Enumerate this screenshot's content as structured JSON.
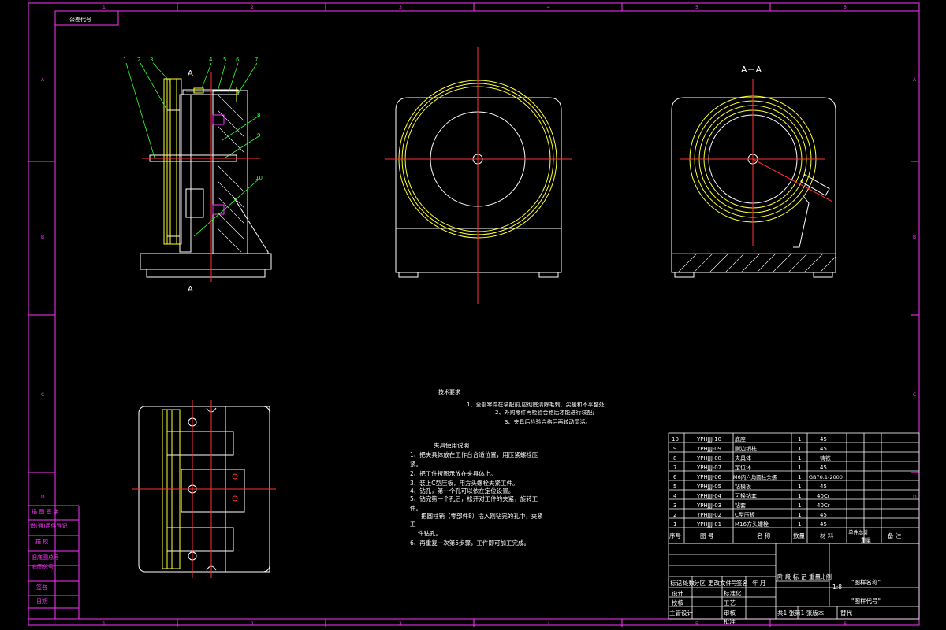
{
  "title_block_top_left": "公差代号",
  "zone_numbers": [
    "1",
    "2",
    "3",
    "4",
    "5",
    "6"
  ],
  "zone_letters": [
    "A",
    "B",
    "C",
    "D"
  ],
  "section_label": "A－A",
  "section_marker_top": "A",
  "section_marker_bottom": "A",
  "balloons": [
    "1",
    "2",
    "3",
    "4",
    "5",
    "6",
    "7",
    "8",
    "9",
    "10"
  ],
  "tech_requirements": {
    "title": "技术要求",
    "items": [
      "1、全部零件在装配前,应彻底清除毛刺、尖棱和不平整处;",
      "2、外购零件再检验合格后才能进行装配;",
      "3、夹具后检验合格后再转动灵活。"
    ]
  },
  "usage": {
    "title": "夹具使用说明",
    "lines": [
      "1、把夹具体放在工作台合适位置，用压紧螺栓压",
      "紧。",
      "2、把工件按图示放在夹具体上。",
      "3、装上C型压板，用方头螺栓夹紧工件。",
      "4、钻孔，第一个孔可以依在定位设置。",
      "5、钻完第一个孔后，松开对工件的夹紧，旋转工",
      "件。",
      "把圆柱销（零部件8）插入刚钻完的孔中，夹紧",
      "工",
      "件钻孔。",
      "6、再重复一次第5步骤，工件即可加工完成。"
    ]
  },
  "bom": {
    "rows": [
      {
        "no": "10",
        "code": "YPHJJJ-10",
        "name": "底座",
        "qty": "1",
        "material": "45"
      },
      {
        "no": "9",
        "code": "YPHJJJ-09",
        "name": "削边销柱",
        "qty": "1",
        "material": "45"
      },
      {
        "no": "8",
        "code": "YPHJJJ-08",
        "name": "夹具体",
        "qty": "1",
        "material": "铸铁"
      },
      {
        "no": "7",
        "code": "YPHJJJ-07",
        "name": "定位环",
        "qty": "1",
        "material": "45"
      },
      {
        "no": "6",
        "code": "YPHJJJ-06",
        "name": "M6内六角圆柱头螺",
        "qty": "1",
        "material": "GB70.1-2000"
      },
      {
        "no": "5",
        "code": "YPHJJJ-05",
        "name": "钻模板",
        "qty": "1",
        "material": "45"
      },
      {
        "no": "4",
        "code": "YPHJJJ-04",
        "name": "可换钻套",
        "qty": "1",
        "material": "40Cr"
      },
      {
        "no": "3",
        "code": "YPHJJJ-03",
        "name": "钻套",
        "qty": "1",
        "material": "40Cr"
      },
      {
        "no": "2",
        "code": "YPHJJJ-02",
        "name": "C型压板",
        "qty": "1",
        "material": "45"
      },
      {
        "no": "1",
        "code": "YPHJJJ-01",
        "name": "M16方头螺栓",
        "qty": "1",
        "material": "45"
      }
    ],
    "header": {
      "no": "序号",
      "code": "图 号",
      "name": "名 称",
      "qty": "数量",
      "material": "材 料",
      "weight": "单件总计",
      "weight2": "重量",
      "note": "备 注"
    }
  },
  "title_block": {
    "mark": "标记",
    "count": "处数",
    "zone": "分区",
    "change": "更改文件号",
    "sign": "签名",
    "date": "年 月",
    "design": "设计",
    "standard": "标准化",
    "check": "校核",
    "process": "工艺",
    "supervisor": "主管设计",
    "review": "审核",
    "approve": "批准",
    "stage": "阶 段 标 记",
    "weight": "重量",
    "scale": "比例",
    "scale_value": "1:8",
    "drawing_name": "\"图样名称\"",
    "drawing_code": "\"图样代号\"",
    "sheets": "共1 张第1 张版本",
    "replace": "替代"
  },
  "left_strip": [
    "借(通)用件登记",
    "旧底图总号",
    "底图总号",
    "签名",
    "日期"
  ],
  "left_strip_top": "描 图 签 字",
  "left_strip_mid": "描 校",
  "colors": {
    "border": "#ff33ff",
    "line": "#ffffff",
    "yellow": "#ffff33",
    "red": "#ff3333",
    "green": "#33ff33",
    "bg": "#000000"
  }
}
